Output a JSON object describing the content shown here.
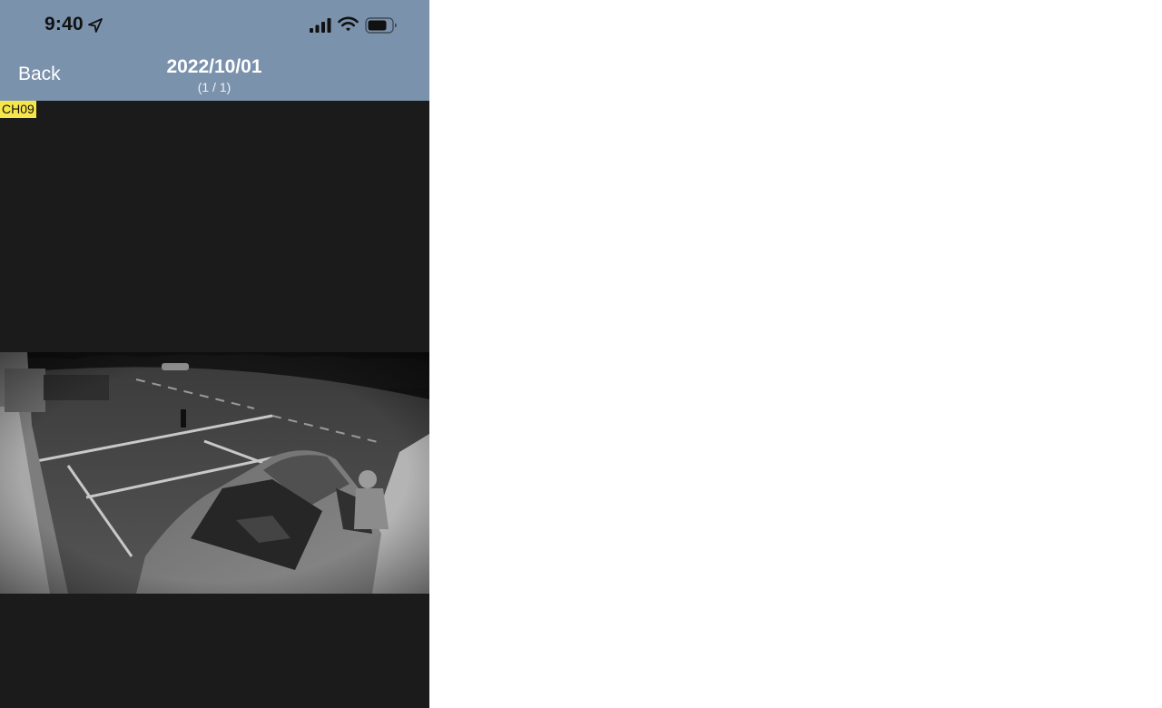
{
  "status_bar": {
    "time": "9:40",
    "icons": [
      "location-arrow-icon",
      "cellular-signal-icon",
      "wifi-icon",
      "battery-icon"
    ]
  },
  "nav": {
    "back_label": "Back",
    "title": "2022/10/01",
    "subtitle": "(1 / 1)"
  },
  "video": {
    "channel_label": "CH09"
  },
  "colors": {
    "header_bg": "#7b92ad",
    "video_bg": "#1b1b1b",
    "channel_badge": "#f7e64a",
    "header_text": "#ffffff"
  }
}
